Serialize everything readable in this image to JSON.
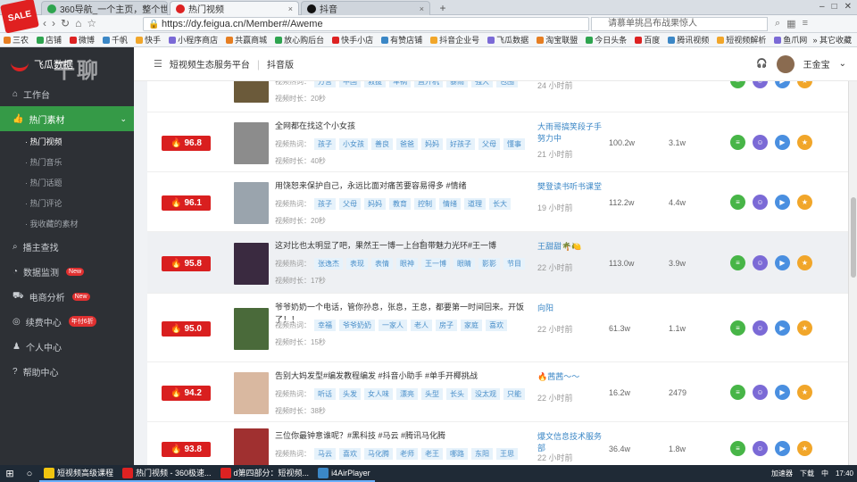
{
  "browser": {
    "tabs": [
      {
        "label": "360导航_一个主页，整个世界",
        "color": "#2ea44f"
      },
      {
        "label": "热门视频",
        "color": "#d22"
      },
      {
        "label": "抖音",
        "color": "#111"
      }
    ],
    "url": "https://dy.feigua.cn/Member#/Aweme",
    "search_placeholder": "请慕单挑吕布战果惊人",
    "bookmarks": [
      "三农",
      "店铺",
      "微博",
      "千帆",
      "快手",
      "小程序商店",
      "共赢商城",
      "放心购后台",
      "快手小店",
      "有赞店铺",
      "抖音企业号",
      "飞瓜数据",
      "淘宝联盟",
      "今日头条",
      "百度",
      "腾讯视频",
      "短视频解析",
      "鱼爪网"
    ],
    "bookmarks_more": "其它收藏"
  },
  "sidebar": {
    "brand": "飞瓜数据",
    "watermark": "千聊",
    "items": [
      {
        "label": "工作台",
        "icon": "home-icon"
      },
      {
        "label": "热门素材",
        "icon": "thumb-icon",
        "active": true
      },
      {
        "label": "播主查找",
        "icon": "search-icon"
      },
      {
        "label": "数据监测",
        "icon": "monitor-icon",
        "badge": "New"
      },
      {
        "label": "电商分析",
        "icon": "cart-icon",
        "badge": "New"
      },
      {
        "label": "续费中心",
        "icon": "renew-icon",
        "badge": "年付6折"
      },
      {
        "label": "个人中心",
        "icon": "user-icon"
      },
      {
        "label": "帮助中心",
        "icon": "help-icon"
      }
    ],
    "subitems": [
      "热门视频",
      "热门音乐",
      "热门话题",
      "热门评论",
      "我收藏的素材"
    ]
  },
  "topbar": {
    "title": "短视频生态服务平台",
    "platform": "抖音版",
    "user": "王金宝"
  },
  "rows": [
    {
      "hot": "",
      "title": "",
      "tags": [
        "方言",
        "中国",
        "救援",
        "车祸",
        "直升机",
        "暴雨",
        "强大",
        "包围"
      ],
      "dur": "视频时长：20秒",
      "author": "",
      "ago": "24 小时前",
      "likes": "",
      "comments": "",
      "img": "#6b5a3a"
    },
    {
      "hot": "96.8",
      "title": "全网都在找这个小女孩",
      "tags": [
        "孩子",
        "小女孩",
        "善良",
        "爸爸",
        "妈妈",
        "好孩子",
        "父母",
        "懂事"
      ],
      "dur": "视频时长：40秒",
      "author": "大雨哥搞笑段子手 努力中",
      "ago": "21 小时前",
      "likes": "100.2w",
      "comments": "3.1w",
      "img": "#8c8c8c"
    },
    {
      "hot": "96.1",
      "title": "用饶恕来保护自己，永远比面对痛苦要容易得多 #情绪",
      "tags": [
        "孩子",
        "父母",
        "妈妈",
        "教育",
        "控制",
        "情绪",
        "道理",
        "长大"
      ],
      "dur": "视频时长：20秒",
      "author": "樊登读书听书课堂",
      "ago": "19 小时前",
      "likes": "112.2w",
      "comments": "4.4w",
      "img": "#9aa4ad"
    },
    {
      "hot": "95.8",
      "title": "这对比也太明显了吧，果然王一博一上台自带魅力光环#王一博",
      "tags": [
        "张逸杰",
        "表现",
        "表情",
        "眼神",
        "王一博",
        "眼睛",
        "影影",
        "节目"
      ],
      "dur": "视频时长：17秒",
      "author": "王甜甜🌴🍋",
      "ago": "22 小时前",
      "likes": "113.0w",
      "comments": "3.9w",
      "img": "#3a2a40"
    },
    {
      "hot": "95.0",
      "title": "爷爷奶奶一个电话，管你孙息，张息，王息，都要第一时间回来。开饭了！！",
      "tags": [
        "幸福",
        "爷爷奶奶",
        "一家人",
        "老人",
        "房子",
        "家庭",
        "喜欢"
      ],
      "dur": "视频时长：15秒",
      "author": "向阳",
      "ago": "22 小时前",
      "likes": "61.3w",
      "comments": "1.1w",
      "img": "#4a6a3a"
    },
    {
      "hot": "94.2",
      "title": "告别大妈发型#编发教程编发 #抖音小助手 #单手开椰挑战",
      "tags": [
        "听话",
        "头发",
        "女人味",
        "漂亮",
        "头型",
        "长头",
        "没太观",
        "只能"
      ],
      "dur": "视频时长：38秒",
      "author": "🔥茜茜～～",
      "ago": "22 小时前",
      "likes": "16.2w",
      "comments": "2479",
      "img": "#d9b8a0"
    },
    {
      "hot": "93.8",
      "title": "三位你最钟意谁呢？#黑科技 #马云 #腾讯马化腾",
      "tags": [
        "马云",
        "喜欢",
        "马化腾",
        "老师",
        "老王",
        "哪路",
        "东阳",
        "王思"
      ],
      "dur": "视频时长：30秒",
      "author": "爆文信息技术服务部",
      "ago": "22 小时前",
      "likes": "36.4w",
      "comments": "1.8w",
      "img": "#a03030"
    }
  ],
  "kw_label": "视频热词：",
  "taskbar": {
    "items": [
      "短视频高级课程",
      "热门视频 - 360极速...",
      "d第四部分：短视频...",
      "i4AirPlayer"
    ],
    "right": [
      "加速器",
      "下载",
      "中",
      "17:40"
    ]
  }
}
